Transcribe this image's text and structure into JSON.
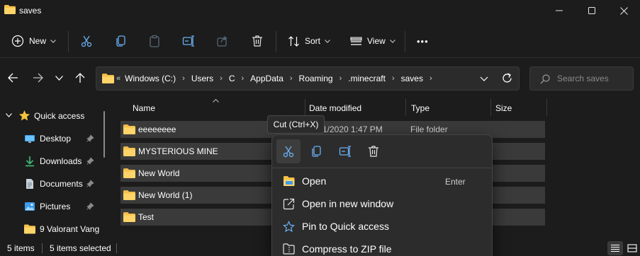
{
  "window": {
    "title": "saves",
    "folder_color": "#f5c04a"
  },
  "toolbar": {
    "new_label": "New",
    "sort_label": "Sort",
    "view_label": "View",
    "more_label": "•••"
  },
  "address": {
    "overflow": "«",
    "crumbs": [
      "Windows (C:)",
      "Users",
      "C",
      "AppData",
      "Roaming",
      ".minecraft",
      "saves"
    ],
    "separator": "›"
  },
  "search": {
    "placeholder": "Search saves"
  },
  "nav": {
    "items": [
      {
        "label": "Quick access",
        "icon": "star-icon"
      },
      {
        "label": "Desktop",
        "icon": "desktop-icon",
        "pinned": true
      },
      {
        "label": "Downloads",
        "icon": "download-icon",
        "pinned": true
      },
      {
        "label": "Documents",
        "icon": "documents-icon",
        "pinned": true
      },
      {
        "label": "Pictures",
        "icon": "pictures-icon",
        "pinned": true
      },
      {
        "label": "9 Valorant Vang",
        "icon": "folder-icon"
      }
    ]
  },
  "columns": {
    "name": "Name",
    "date": "Date modified",
    "type": "Type",
    "size": "Size"
  },
  "files": [
    {
      "name": "eeeeeeee",
      "date": "1/2020 1:47 PM",
      "type": "File folder"
    },
    {
      "name": "MYSTERIOUS MINE",
      "date": "",
      "type": ""
    },
    {
      "name": "New World",
      "date": "",
      "type": ""
    },
    {
      "name": "New World (1)",
      "date": "",
      "type": ""
    },
    {
      "name": "Test",
      "date": "",
      "type": ""
    }
  ],
  "status": {
    "count": "5 items",
    "selected": "5 items selected"
  },
  "tooltip": "Cut (Ctrl+X)",
  "context_menu": {
    "items": [
      {
        "label": "Open",
        "shortcut": "Enter"
      },
      {
        "label": "Open in new window"
      },
      {
        "label": "Pin to Quick access"
      },
      {
        "label": "Compress to ZIP file"
      }
    ]
  }
}
